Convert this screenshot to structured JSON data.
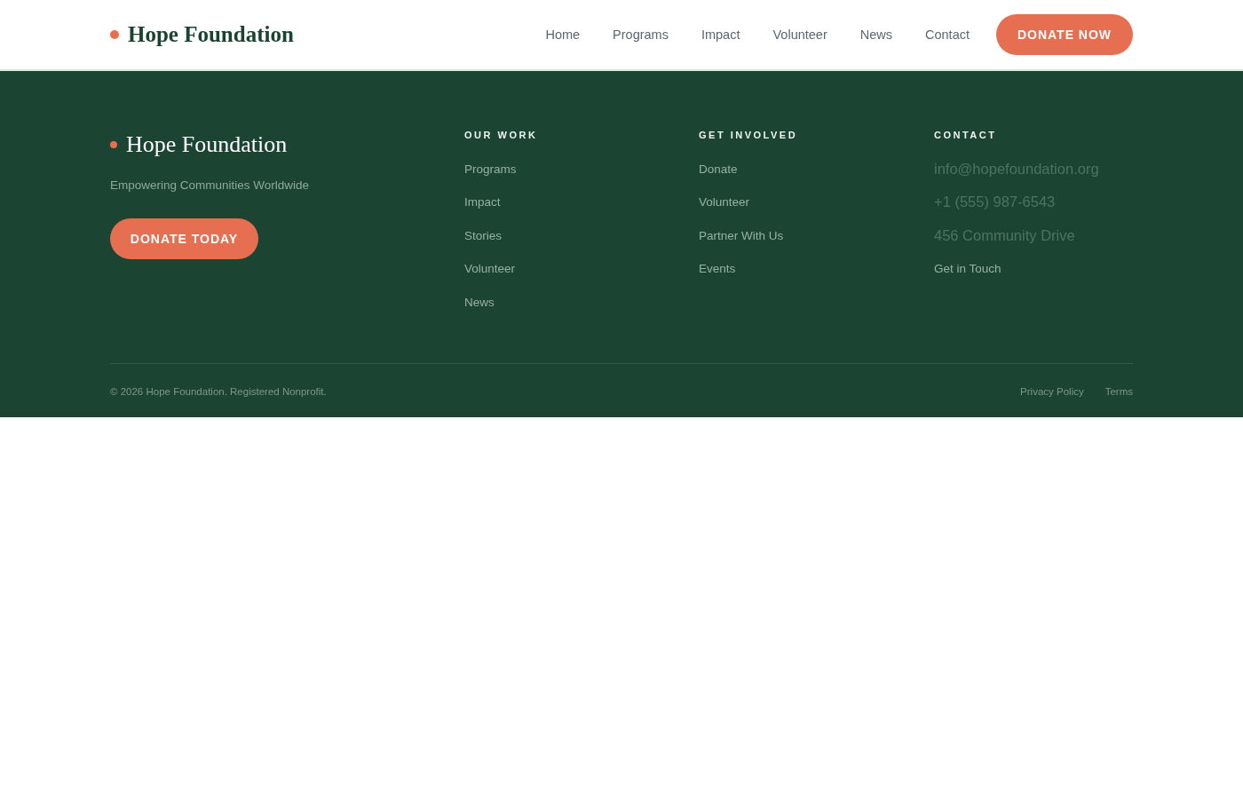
{
  "header": {
    "logo": "Hope Foundation",
    "nav": [
      {
        "label": "Home"
      },
      {
        "label": "Programs"
      },
      {
        "label": "Impact"
      },
      {
        "label": "Volunteer"
      },
      {
        "label": "News"
      },
      {
        "label": "Contact"
      }
    ],
    "cta": "DONATE NOW"
  },
  "footer": {
    "brand": {
      "name": "Hope Foundation",
      "tagline": "Empowering Communities Worldwide",
      "cta": "DONATE TODAY"
    },
    "columns": [
      {
        "title": "OUR WORK",
        "items": [
          {
            "label": "Programs",
            "kind": "link"
          },
          {
            "label": "Impact",
            "kind": "link"
          },
          {
            "label": "Stories",
            "kind": "link"
          },
          {
            "label": "Volunteer",
            "kind": "link"
          },
          {
            "label": "News",
            "kind": "link"
          }
        ]
      },
      {
        "title": "GET INVOLVED",
        "items": [
          {
            "label": "Donate",
            "kind": "link"
          },
          {
            "label": "Volunteer",
            "kind": "link"
          },
          {
            "label": "Partner With Us",
            "kind": "link"
          },
          {
            "label": "Events",
            "kind": "link"
          }
        ]
      },
      {
        "title": "CONTACT",
        "items": [
          {
            "label": "info@hopefoundation.org",
            "kind": "info"
          },
          {
            "label": "+1 (555) 987-6543",
            "kind": "info"
          },
          {
            "label": "456 Community Drive",
            "kind": "info"
          },
          {
            "label": "Get in Touch",
            "kind": "link"
          }
        ]
      }
    ],
    "copyright": "© 2026 Hope Foundation. Registered Nonprofit.",
    "legal_links": [
      "Privacy Policy",
      "Terms"
    ]
  }
}
